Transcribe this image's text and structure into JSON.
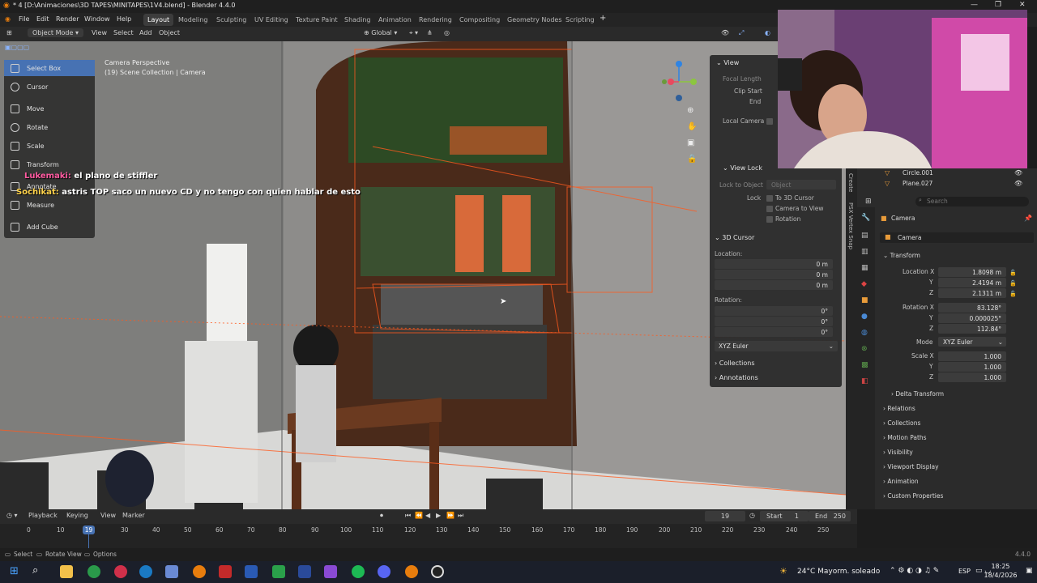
{
  "window": {
    "title": "* 4 [D:\\Animaciones\\3D TAPES\\MINITAPES\\1V4.blend] - Blender 4.4.0"
  },
  "menu": {
    "file": "File",
    "edit": "Edit",
    "render": "Render",
    "window": "Window",
    "help": "Help"
  },
  "workspaces": [
    "Layout",
    "Modeling",
    "Sculpting",
    "UV Editing",
    "Texture Paint",
    "Shading",
    "Animation",
    "Rendering",
    "Compositing",
    "Geometry Nodes",
    "Scripting"
  ],
  "viewport_header": {
    "mode": "Object Mode",
    "view": "View",
    "select": "Select",
    "add": "Add",
    "object": "Object",
    "orientation": "Global"
  },
  "viewport": {
    "camera_title": "Camera Perspective",
    "collection": "(19) Scene Collection | Camera"
  },
  "tools": [
    "Select Box",
    "Cursor",
    "Move",
    "Rotate",
    "Scale",
    "Transform",
    "Annotate",
    "Measure",
    "Add Cube"
  ],
  "chat": [
    {
      "user": "Lukemaki:",
      "message": "el plano de stiffler"
    },
    {
      "user": "Sochikat:",
      "message": "astris TOP saco un nuevo CD y no tengo con quien hablar de esto"
    }
  ],
  "npanel": {
    "view": "View",
    "focal_length": "Focal Length",
    "clip_start": "Clip Start",
    "end": "End",
    "local_camera": "Local Camera",
    "view_lock": "View Lock",
    "lock_to_object": "Lock to Object",
    "object_placeholder": "Object",
    "lock": "Lock",
    "to_3d_cursor": "To 3D Cursor",
    "camera_to_view": "Camera to View",
    "rotation": "Rotation",
    "cursor_header": "3D Cursor",
    "location_label": "Location:",
    "loc_x": "0 m",
    "loc_y": "0 m",
    "loc_z": "0 m",
    "rotation_label": "Rotation:",
    "rot_x": "0°",
    "rot_y": "0°",
    "rot_z": "0°",
    "rot_mode": "XYZ Euler",
    "collections": "Collections",
    "annotations": "Annotations",
    "tab_create": "Create",
    "tab_vertex": "PSX Vertex Snap"
  },
  "outliner": {
    "items": [
      "Circle.001",
      "Plane.027"
    ]
  },
  "properties": {
    "search": "Search",
    "object_name": "Camera",
    "datablock": "Camera",
    "transform": "Transform",
    "location_x_label": "Location X",
    "location_x": "1.8098 m",
    "location_y": "2.4194 m",
    "location_z": "2.1311 m",
    "rotation_x_label": "Rotation X",
    "rotation_x": "83.128°",
    "rotation_y": "0.000025°",
    "rotation_z": "112.84°",
    "mode_label": "Mode",
    "mode": "XYZ Euler",
    "scale_x_label": "Scale X",
    "scale_x": "1.000",
    "scale_y": "1.000",
    "scale_z": "1.000",
    "y": "Y",
    "z": "Z",
    "sections": [
      "Delta Transform",
      "Relations",
      "Collections",
      "Motion Paths",
      "Visibility",
      "Viewport Display",
      "Animation",
      "Custom Properties"
    ]
  },
  "timeline": {
    "playback": "Playback",
    "keying": "Keying",
    "view": "View",
    "marker": "Marker",
    "current_frame": "19",
    "start_label": "Start",
    "start": "1",
    "end_label": "End",
    "end": "250",
    "ruler": [
      "0",
      "10",
      "19",
      "30",
      "40",
      "50",
      "60",
      "70",
      "80",
      "90",
      "100",
      "110",
      "120",
      "130",
      "140",
      "150",
      "160",
      "170",
      "180",
      "190",
      "200",
      "210",
      "220",
      "230",
      "240",
      "250"
    ]
  },
  "status": {
    "select": "Select",
    "rotate_view": "Rotate View",
    "options": "Options",
    "version": "4.4.0"
  },
  "taskbar": {
    "weather": "24°C  Mayorm. soleado",
    "lang": "ESP",
    "time": "18:25",
    "date": "18/4/2026"
  }
}
